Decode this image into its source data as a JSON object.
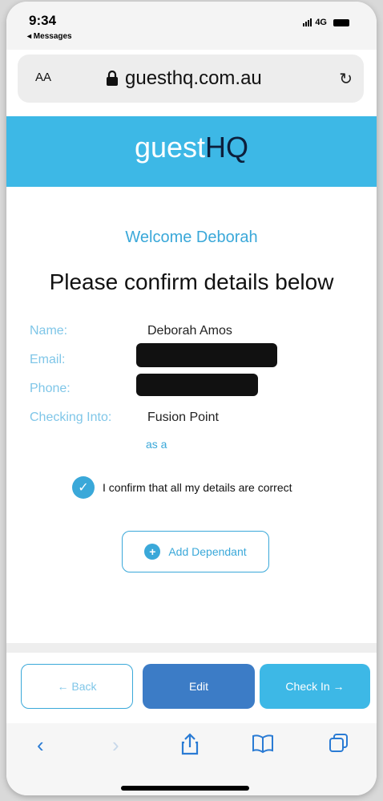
{
  "status": {
    "time": "9:34",
    "back_app": "◂ Messages",
    "network": "4G"
  },
  "browser": {
    "text_size": "AA",
    "url": "guesthq.com.au"
  },
  "brand": {
    "logo_light": "guest",
    "logo_dark": "HQ",
    "header_color": "#3db8e6"
  },
  "page": {
    "welcome": "Welcome Deborah",
    "heading": "Please confirm details below",
    "fields": {
      "name_label": "Name:",
      "name_value": "Deborah Amos",
      "email_label": "Email:",
      "phone_label": "Phone:",
      "checking_label": "Checking Into:",
      "checking_value": "Fusion Point",
      "as_a": "as a"
    },
    "confirm_text": "I confirm that all my details are correct",
    "add_dependant": "Add Dependant"
  },
  "actions": {
    "back": "← Back",
    "edit": "Edit",
    "check_in": "Check In →"
  },
  "icons": {
    "lock": "lock-icon",
    "reload": "reload-icon",
    "check": "checkmark-icon",
    "plus": "plus-icon",
    "nav_back": "chevron-left-icon",
    "nav_forward": "chevron-right-icon",
    "share": "share-icon",
    "bookmarks": "book-icon",
    "tabs": "tabs-icon"
  }
}
